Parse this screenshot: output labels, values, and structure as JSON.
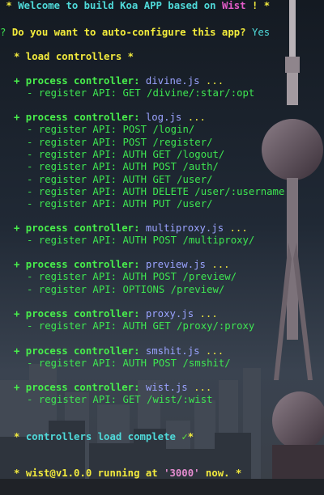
{
  "terminal": {
    "welcome": {
      "star_open": " * ",
      "text": "Welcome to build Koa APP based on ",
      "brand": "Wist",
      "suffix": " ! *"
    },
    "prompt": {
      "mark": "?",
      "question": "Do you want to auto-configure this app?",
      "answer": "Yes"
    },
    "load_header": "* load controllers *",
    "process_prefix": "+ process controller: ",
    "process_suffix": " ...",
    "controllers": [
      {
        "file": "divine.js",
        "apis": [
          "- register API: GET /divine/:star/:opt"
        ]
      },
      {
        "file": "log.js",
        "apis": [
          "- register API: POST /login/",
          "- register API: POST /register/",
          "- register API: AUTH GET /logout/",
          "- register API: AUTH POST /auth/",
          "- register API: AUTH GET /user/",
          "- register API: AUTH DELETE /user/:username",
          "- register API: AUTH PUT /user/"
        ]
      },
      {
        "file": "multiproxy.js",
        "apis": [
          "- register API: AUTH POST /multiproxy/"
        ]
      },
      {
        "file": "preview.js",
        "apis": [
          "- register API: AUTH POST /preview/",
          "- register API: OPTIONS /preview/"
        ]
      },
      {
        "file": "proxy.js",
        "apis": [
          "- register API: AUTH GET /proxy/:proxy"
        ]
      },
      {
        "file": "smshit.js",
        "apis": [
          "- register API: AUTH POST /smshit/"
        ]
      },
      {
        "file": "wist.js",
        "apis": [
          "- register API: GET /wist/:wist"
        ]
      }
    ],
    "complete": {
      "star_open": "* ",
      "text": "controllers load complete ",
      "check": "✓",
      "star_close": "*"
    },
    "running": {
      "star_open": "* ",
      "name": "wist@v1.0.0",
      "text": " running at ",
      "port": "'3000'",
      "suffix": " now. *"
    }
  },
  "colors": {
    "background": "#1c2430",
    "yellow": "#f2ea3d",
    "cyan": "#4fd9d9",
    "green": "#3ee651",
    "magenta": "#e45cc9",
    "purple": "#9aa3ff"
  }
}
